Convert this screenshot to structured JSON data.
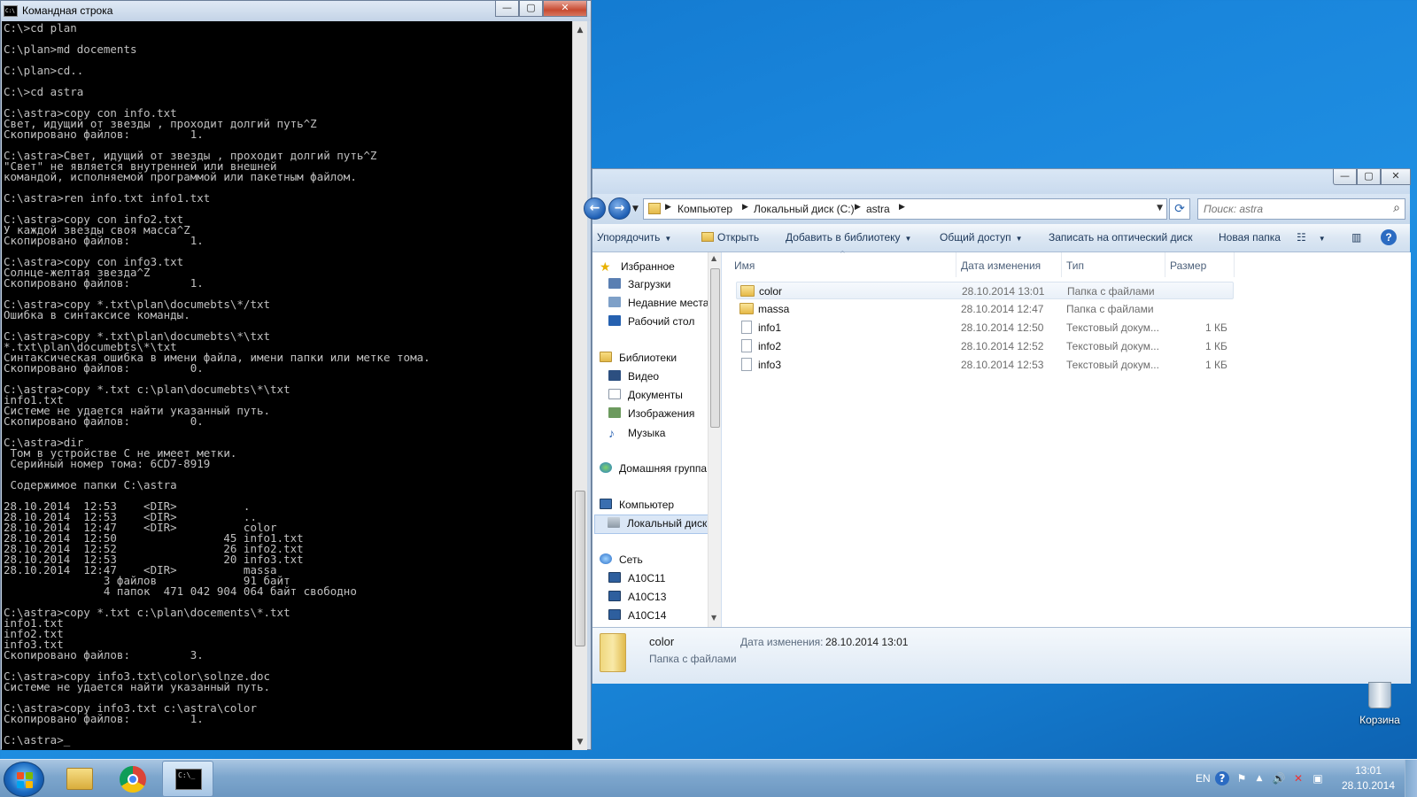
{
  "cmd": {
    "title": "Командная строка",
    "output": "C:\\>cd plan\n\nC:\\plan>md docements\n\nC:\\plan>cd..\n\nC:\\>cd astra\n\nC:\\astra>copy con info.txt\nСвет, идущий от звезды , проходит долгий путь^Z\nСкопировано файлов:         1.\n\nC:\\astra>Свет, идущий от звезды , проходит долгий путь^Z\n\"Свет\" не является внутренней или внешней\nкомандой, исполняемой программой или пакетным файлом.\n\nC:\\astra>ren info.txt info1.txt\n\nC:\\astra>copy con info2.txt\nУ каждой звезды своя масса^Z\nСкопировано файлов:         1.\n\nC:\\astra>copy con info3.txt\nСолнце-желтая звезда^Z\nСкопировано файлов:         1.\n\nC:\\astra>copy *.txt\\plan\\documebts\\*/txt\nОшибка в синтаксисе команды.\n\nC:\\astra>copy *.txt\\plan\\documebts\\*\\txt\n*.txt\\plan\\documebts\\*\\txt\nСинтаксическая ошибка в имени файла, имени папки или метке тома.\nСкопировано файлов:         0.\n\nC:\\astra>copy *.txt c:\\plan\\documebts\\*\\txt\ninfo1.txt\nСистеме не удается найти указанный путь.\nСкопировано файлов:         0.\n\nC:\\astra>dir\n Том в устройстве C не имеет метки.\n Серийный номер тома: 6CD7-8919\n\n Содержимое папки C:\\astra\n\n28.10.2014  12:53    <DIR>          .\n28.10.2014  12:53    <DIR>          ..\n28.10.2014  12:47    <DIR>          color\n28.10.2014  12:50                45 info1.txt\n28.10.2014  12:52                26 info2.txt\n28.10.2014  12:53                20 info3.txt\n28.10.2014  12:47    <DIR>          massa\n               3 файлов             91 байт\n               4 папок  471 042 904 064 байт свободно\n\nC:\\astra>copy *.txt c:\\plan\\docements\\*.txt\ninfo1.txt\ninfo2.txt\ninfo3.txt\nСкопировано файлов:         3.\n\nC:\\astra>copy info3.txt\\color\\solnze.doc\nСистеме не удается найти указанный путь.\n\nC:\\astra>copy info3.txt c:\\astra\\color\nСкопировано файлов:         1.\n\nC:\\astra>_",
    "icon_text": "C:\\",
    "minimize": "—",
    "maximize": "▢",
    "close": "✕"
  },
  "explorer": {
    "breadcrumbs": [
      "Компьютер",
      "Локальный диск (C:)",
      "astra"
    ],
    "search_placeholder": "Поиск: astra",
    "toolbar": {
      "organize": "Упорядочить",
      "open": "Открыть",
      "add_to_library": "Добавить в библиотеку",
      "share": "Общий доступ",
      "burn": "Записать на оптический диск",
      "new_folder": "Новая папка"
    },
    "nav": {
      "favorites": "Избранное",
      "downloads": "Загрузки",
      "recent": "Недавние места",
      "desktop": "Рабочий стол",
      "libraries": "Библиотеки",
      "video": "Видео",
      "documents": "Документы",
      "images": "Изображения",
      "music": "Музыка",
      "homegroup": "Домашняя группа",
      "computer": "Компьютер",
      "local_disk": "Локальный диск",
      "network": "Сеть",
      "pc1": "A10C11",
      "pc2": "A10C13",
      "pc3": "A10C14"
    },
    "columns": {
      "name": "Имя",
      "date": "Дата изменения",
      "type": "Тип",
      "size": "Размер"
    },
    "files": [
      {
        "name": "color",
        "date": "28.10.2014 13:01",
        "type": "Папка с файлами",
        "size": ""
      },
      {
        "name": "massa",
        "date": "28.10.2014 12:47",
        "type": "Папка с файлами",
        "size": ""
      },
      {
        "name": "info1",
        "date": "28.10.2014 12:50",
        "type": "Текстовый докум...",
        "size": "1 КБ"
      },
      {
        "name": "info2",
        "date": "28.10.2014 12:52",
        "type": "Текстовый докум...",
        "size": "1 КБ"
      },
      {
        "name": "info3",
        "date": "28.10.2014 12:53",
        "type": "Текстовый докум...",
        "size": "1 КБ"
      }
    ],
    "details": {
      "name": "color",
      "kind": "Папка с файлами",
      "date_label": "Дата изменения:",
      "date_value": "28.10.2014 13:01"
    }
  },
  "desktop": {
    "recycle_bin": "Корзина"
  },
  "taskbar": {
    "lang": "EN",
    "time": "13:01",
    "date": "28.10.2014"
  }
}
